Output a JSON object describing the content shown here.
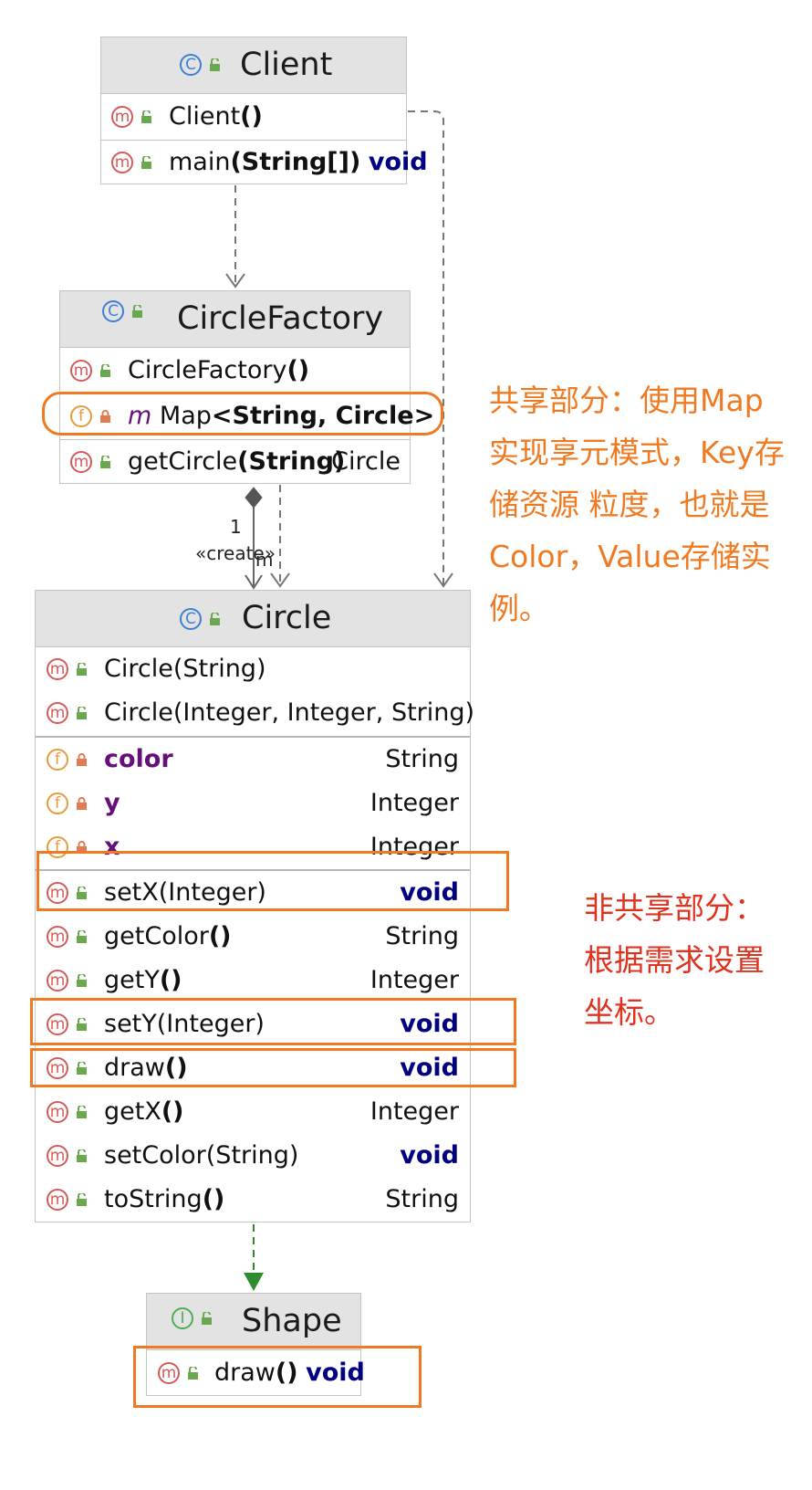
{
  "client": {
    "title": "Client",
    "members": [
      {
        "badge": "m",
        "name": "Client",
        "params": "()"
      },
      {
        "badge": "m",
        "name": "main",
        "params": "(String[])",
        "type": "void"
      }
    ]
  },
  "factory": {
    "title": "CircleFactory",
    "members": [
      {
        "badge": "m",
        "name": "CircleFactory",
        "params": "()"
      },
      {
        "badge": "f",
        "name": "m",
        "type_prefix": "Map",
        "generic": "<String, Circle>"
      },
      {
        "badge": "m",
        "name": "getCircle",
        "params": "(String)",
        "type": "Circle"
      }
    ]
  },
  "relation": {
    "multiplicity": "1",
    "stereotype": "«create»",
    "role": "m"
  },
  "circle": {
    "title": "Circle",
    "constructors": [
      {
        "badge": "m",
        "name": "Circle",
        "params": "(String)"
      },
      {
        "badge": "m",
        "name": "Circle",
        "params": "(Integer, Integer, String)"
      }
    ],
    "fields": [
      {
        "badge": "f",
        "name": "color",
        "type": "String"
      },
      {
        "badge": "f",
        "name": "y",
        "type": "Integer"
      },
      {
        "badge": "f",
        "name": "x",
        "type": "Integer"
      }
    ],
    "methods": [
      {
        "badge": "m",
        "name": "setX",
        "params": "(Integer)",
        "type": "void"
      },
      {
        "badge": "m",
        "name": "getColor",
        "params": "()",
        "type": "String"
      },
      {
        "badge": "m",
        "name": "getY",
        "params": "()",
        "type": "Integer"
      },
      {
        "badge": "m",
        "name": "setY",
        "params": "(Integer)",
        "type": "void"
      },
      {
        "badge": "m",
        "name": "draw",
        "params": "()",
        "type": "void"
      },
      {
        "badge": "m",
        "name": "getX",
        "params": "()",
        "type": "Integer"
      },
      {
        "badge": "m",
        "name": "setColor",
        "params": "(String)",
        "type": "void"
      },
      {
        "badge": "m",
        "name": "toString",
        "params": "()",
        "type": "String"
      }
    ]
  },
  "shape": {
    "title": "Shape",
    "members": [
      {
        "badge": "m",
        "name": "draw",
        "params": "()",
        "type": "void"
      }
    ]
  },
  "badges": {
    "class": "C",
    "method": "m",
    "field": "f",
    "interface": "I"
  },
  "notes": {
    "shared": "共享部分：使用Map实现享元模式，Key存储资源 粒度，也就是Color，Value存储实例。",
    "non_shared": "非共享部分：根据需求设置坐标。"
  },
  "colors": {
    "highlight": "#f07a22",
    "note_shared": "#f07a22",
    "note_non_shared": "#e0331f",
    "keyword": "#000080",
    "field": "#660e7a",
    "implements_arrow": "#2e8b2e"
  }
}
